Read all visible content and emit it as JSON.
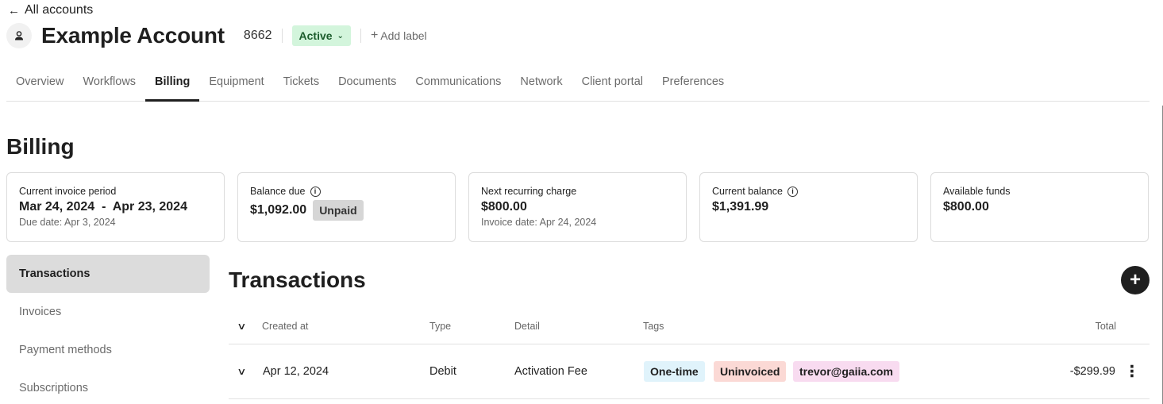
{
  "nav": {
    "back_label": "All accounts"
  },
  "account": {
    "title": "Example Account",
    "number": "8662",
    "status": "Active",
    "add_label": "Add label"
  },
  "tabs": [
    {
      "label": "Overview"
    },
    {
      "label": "Workflows"
    },
    {
      "label": "Billing",
      "active": true
    },
    {
      "label": "Equipment"
    },
    {
      "label": "Tickets"
    },
    {
      "label": "Documents"
    },
    {
      "label": "Communications"
    },
    {
      "label": "Network"
    },
    {
      "label": "Client portal"
    },
    {
      "label": "Preferences"
    }
  ],
  "billing": {
    "title": "Billing",
    "cards": [
      {
        "label": "Current invoice period",
        "value": "Mar 24, 2024  -  Apr 23, 2024",
        "sub": "Due date: Apr 3, 2024"
      },
      {
        "label": "Balance due",
        "value": "$1,092.00",
        "badge": "Unpaid"
      },
      {
        "label": "Next recurring charge",
        "value": "$800.00",
        "sub": "Invoice date: Apr 24, 2024"
      },
      {
        "label": "Current balance",
        "value": "$1,391.99"
      },
      {
        "label": "Available funds",
        "value": "$800.00"
      }
    ]
  },
  "subnav": [
    {
      "label": "Transactions",
      "active": true
    },
    {
      "label": "Invoices"
    },
    {
      "label": "Payment methods"
    },
    {
      "label": "Subscriptions"
    }
  ],
  "transactions": {
    "title": "Transactions",
    "columns": {
      "created_at": "Created at",
      "type": "Type",
      "detail": "Detail",
      "tags": "Tags",
      "total": "Total"
    },
    "rows": [
      {
        "created_at": "Apr 12, 2024",
        "type": "Debit",
        "detail": "Activation Fee",
        "tags": [
          "One-time",
          "Uninvoiced",
          "trevor@gaiia.com"
        ],
        "total": "-$299.99"
      }
    ]
  },
  "colors": {
    "status_bg": "#d3f5dc",
    "tag_one_time": "#e0f3fb",
    "tag_uninvoiced": "#fbd9d5",
    "tag_user": "#f8dbf0"
  },
  "icons": [
    "arrow-left-icon",
    "user-icon",
    "chevron-down-icon",
    "plus-icon",
    "info-icon",
    "more-vertical-icon"
  ]
}
